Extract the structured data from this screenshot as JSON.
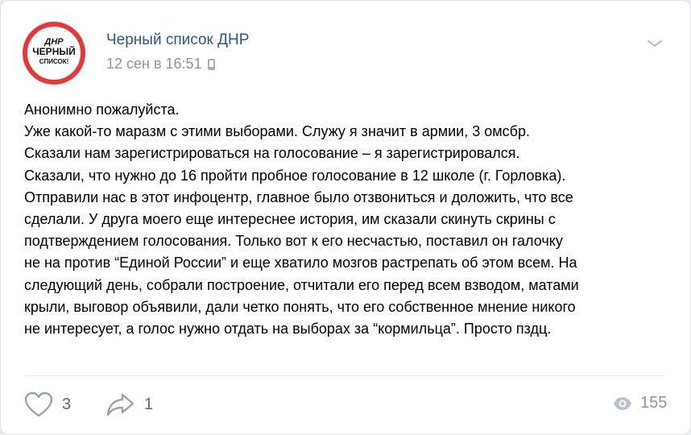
{
  "post": {
    "author": "Черный список ДНР",
    "date": "12 сен в 16:51",
    "avatar_text": [
      "ДНР",
      "ЧЕРНЫЙ",
      "СПИСОК!"
    ],
    "body_lines": [
      "Анонимно пожалуйста.",
      "Уже какой-то маразм с этими выборами. Служу я значит в армии, 3 омсбр.",
      "Сказали нам зарегистрироваться на голосование – я зарегистрировался.",
      "Сказали, что нужно до 16 пройти пробное голосование в 12 школе (г. Горловка).",
      "Отправили нас в этот инфоцентр, главное было отзвониться и доложить, что все",
      "сделали. У друга моего еще интереснее история, им сказали скинуть скрины с",
      "подтверждением голосования. Только вот к его несчастью, поставил он галочку",
      "не на против “Единой России” и еще хватило мозгов растрепать об этом всем. На",
      "следующий день, собрали построение, отчитали его перед всем взводом, матами",
      "крыли, выговор объявили, дали четко понять, что его собственное мнение никого",
      "не интересует, а голос нужно отдать на выборах за “кормильца”. Просто пздц."
    ]
  },
  "actions": {
    "likes": "3",
    "shares": "1",
    "views": "155"
  },
  "icons": {
    "like": "heart-icon",
    "share": "share-arrow-icon",
    "views": "eye-icon",
    "menu": "chevron-down-icon",
    "device": "phone-icon"
  },
  "colors": {
    "link": "#2a5885",
    "muted": "#939393",
    "avatar_ring": "#e63838"
  }
}
